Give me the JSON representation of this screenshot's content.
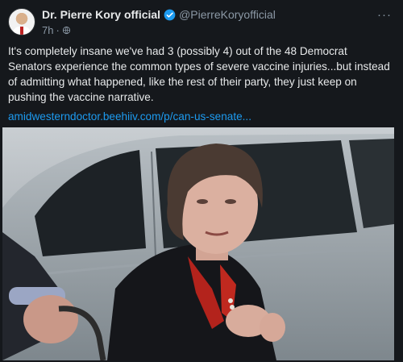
{
  "post": {
    "display_name": "Dr. Pierre Kory official",
    "handle": "@PierreKoryofficial",
    "timestamp": "7h",
    "separator": "·",
    "more_label": "···",
    "text": "It's completely insane we've had 3 (possibly 4) out of the 48 Democrat Senators experience the common types of severe vaccine injuries...but instead of admitting what happened, like the rest of their party, they just keep on pushing the vaccine narrative.",
    "link_text": "amidwesterndoctor.beehiiv.com/p/can-us-senate...",
    "icons": {
      "verified": "verified-badge-icon",
      "globe": "globe-icon",
      "more": "more-options-icon"
    }
  },
  "colors": {
    "background": "#15181c",
    "link": "#1d9bf0",
    "verified": "#1d9bf0",
    "muted": "#8b98a5"
  }
}
